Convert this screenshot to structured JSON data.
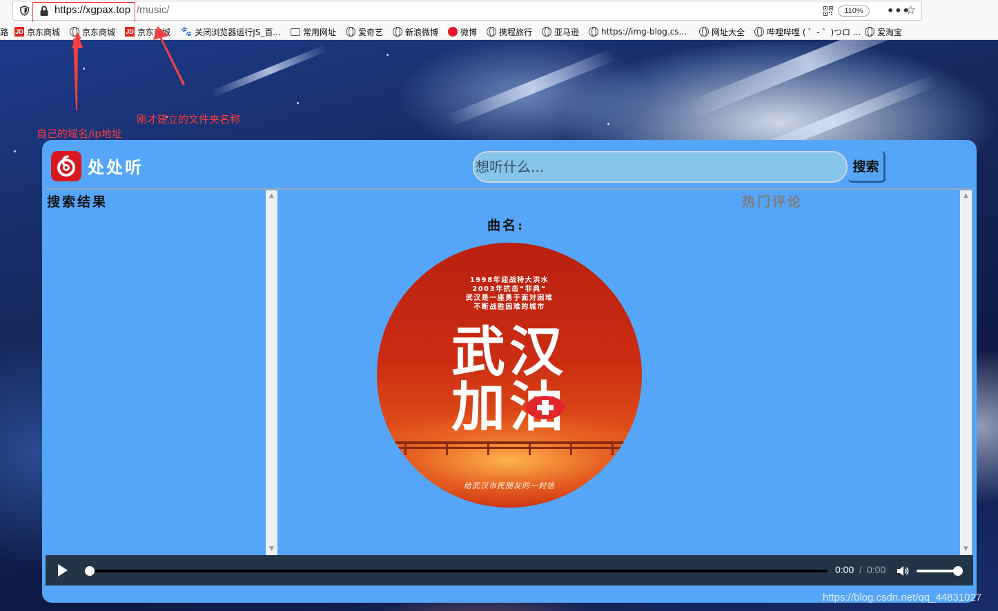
{
  "browser": {
    "url_domain": "https://xgpax.top",
    "url_path": "/music/",
    "zoom": "110%",
    "icons": [
      "shield-icon",
      "lock-icon",
      "qr-code-icon",
      "more-icon",
      "bookmark-star-icon"
    ]
  },
  "bookmarks": {
    "cut_label": "路",
    "items": [
      {
        "label": "京东商城",
        "icon": "jd-icon"
      },
      {
        "label": "京东商城",
        "icon": "globe-icon"
      },
      {
        "label": "京东商城",
        "icon": "jd-icon"
      },
      {
        "label": "关闭浏览器运行JS_百...",
        "icon": "baidu-paw-icon"
      },
      {
        "label": "常用网址",
        "icon": "folder-icon"
      },
      {
        "label": "爱奇艺",
        "icon": "globe-icon"
      },
      {
        "label": "新浪微博",
        "icon": "globe-icon"
      },
      {
        "label": "微博",
        "icon": "weibo-icon"
      },
      {
        "label": "携程旅行",
        "icon": "globe-icon"
      },
      {
        "label": "亚马逊",
        "icon": "globe-icon"
      },
      {
        "label": "https://img-blog.cs...",
        "icon": "globe-icon"
      },
      {
        "label": "网址大全",
        "icon": "globe-icon"
      },
      {
        "label": "哔哩哔哩 ( ゜- ゜)つロ ...",
        "icon": "globe-icon"
      },
      {
        "label": "爱淘宝",
        "icon": "globe-icon"
      }
    ]
  },
  "annotations": {
    "domain_note": "自己的域名/ip地址",
    "folder_note": "刚才建立的文件夹名称",
    "color": "#ff3b3b"
  },
  "app": {
    "title": "处处听",
    "search_placeholder": "想听什么...",
    "search_button": "搜索",
    "results_heading": "搜索结果",
    "song_label": "曲名:",
    "comments_heading": "热门评论",
    "accent": "#55a6f8",
    "logo_color": "#d8181f"
  },
  "album_art": {
    "lines": [
      "1998年迎战特大洪水",
      "2003年抗击“非典”",
      "武汉是一座勇于面对困难",
      "不断战胜困难的城市"
    ],
    "headline_1": "武汉",
    "headline_2": "加油",
    "footer": "给武汉市民朋友的一封信"
  },
  "player": {
    "current_time": "0:00",
    "separator": "/",
    "duration": "0:00",
    "progress": 0,
    "volume": 1.0
  },
  "watermark": "https://blog.csdn.net/qq_44831027"
}
